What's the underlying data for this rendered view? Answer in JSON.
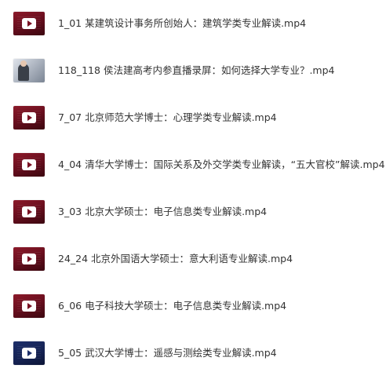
{
  "files": [
    {
      "name": "1_01 某建筑设计事务所创始人：建筑学类专业解读.mp4",
      "thumb": "play-icon"
    },
    {
      "name": "118_118 侯法建高考内参直播录屏：如何选择大学专业？.mp4",
      "thumb": "photo"
    },
    {
      "name": "7_07 北京师范大学博士：心理学类专业解读.mp4",
      "thumb": "play-icon"
    },
    {
      "name": "4_04 清华大学博士：国际关系及外交学类专业解读，“五大官校”解读.mp4",
      "thumb": "play-icon"
    },
    {
      "name": "3_03 北京大学硕士：电子信息类专业解读.mp4",
      "thumb": "play-icon"
    },
    {
      "name": "24_24 北京外国语大学硕士：意大利语专业解读.mp4",
      "thumb": "play-icon"
    },
    {
      "name": "6_06 电子科技大学硕士：电子信息类专业解读.mp4",
      "thumb": "play-icon"
    },
    {
      "name": "5_05 武汉大学博士：遥感与测绘类专业解读.mp4",
      "thumb": "play-icon"
    }
  ]
}
